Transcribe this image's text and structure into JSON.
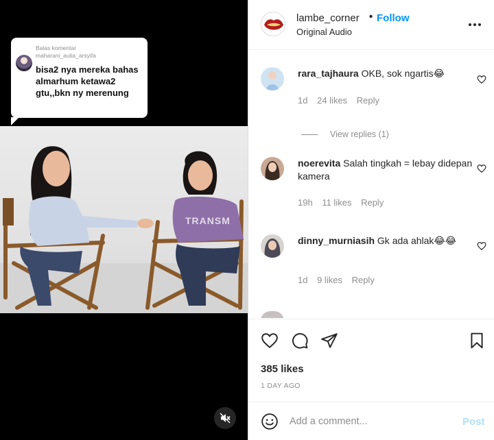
{
  "video": {
    "reply_card": {
      "label": "Balas komentar",
      "username": "maharani_aulia_arsyifa",
      "text": "bisa2 nya mereka bahas almarhum ketawa2 gtu,,bkn ny merenung"
    },
    "watermark": "TRANSM",
    "mute_icon": "speaker-muted-icon"
  },
  "header": {
    "username": "lambe_corner",
    "separator": "•",
    "follow_label": "Follow",
    "audio": "Original Audio",
    "more_icon": "more-horizontal-icon"
  },
  "comments": [
    {
      "username": "rara_tajhaura",
      "text": "OKB, sok ngartis😂",
      "age": "1d",
      "likes": "24 likes",
      "reply": "Reply"
    },
    {
      "username": "noerevita",
      "text": "Salah tingkah = lebay didepan kamera",
      "age": "19h",
      "likes": "11 likes",
      "reply": "Reply"
    },
    {
      "username": "dinny_murniasih",
      "text": "Gk ada ahlak😂😂",
      "age": "1d",
      "likes": "9 likes",
      "reply": "Reply"
    }
  ],
  "view_replies": "View replies (1)",
  "actions": {
    "likes": "385 likes",
    "time_ago": "1 DAY AGO",
    "icons": [
      "heart-icon",
      "comment-icon",
      "share-icon",
      "bookmark-icon"
    ]
  },
  "add_comment": {
    "placeholder": "Add a comment...",
    "post_label": "Post"
  },
  "colors": {
    "accent": "#0095f6",
    "post_disabled": "#b2dffc",
    "muted_text": "#8e8e8e",
    "video_bg": "#000000"
  }
}
